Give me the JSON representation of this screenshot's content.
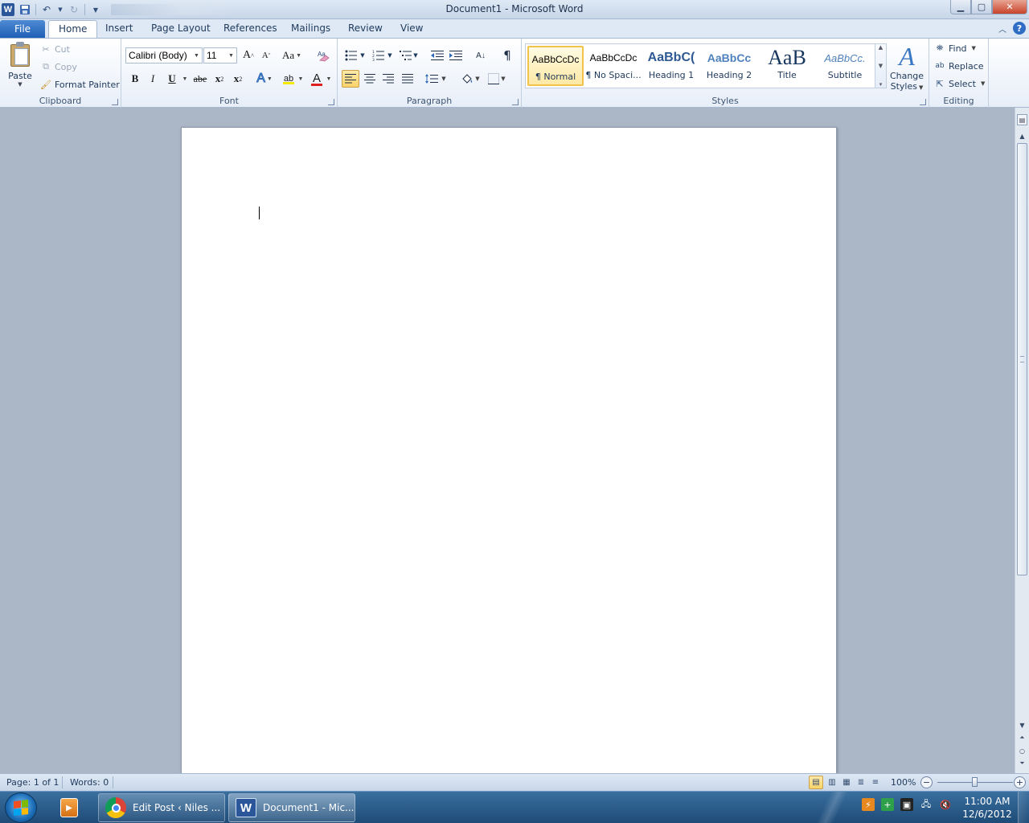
{
  "window": {
    "title": "Document1  -  Microsoft Word",
    "qat_icons": [
      "word-logo-icon",
      "save-icon",
      "undo-icon",
      "redo-icon",
      "customize-qat-icon"
    ],
    "controls": {
      "minimize": "▁",
      "maximize": "▢",
      "close": "✕"
    }
  },
  "tabs": {
    "file": "File",
    "items": [
      "Home",
      "Insert",
      "Page Layout",
      "References",
      "Mailings",
      "Review",
      "View"
    ],
    "active": "Home",
    "help": "?"
  },
  "ribbon": {
    "clipboard": {
      "label": "Clipboard",
      "paste": "Paste",
      "cut": "Cut",
      "copy": "Copy",
      "format_painter": "Format Painter"
    },
    "font": {
      "label": "Font",
      "font_name": "Calibri (Body)",
      "font_size": "11",
      "grow": "A",
      "shrink": "A",
      "change_case": "Aa",
      "bold": "B",
      "italic": "I",
      "underline": "U",
      "strike": "abe",
      "subscript": "x",
      "superscript": "x",
      "text_effects": "A",
      "highlight": "ab",
      "font_color": "A",
      "colors": {
        "font_color": "#e02020",
        "highlight": "#f4e800"
      }
    },
    "paragraph": {
      "label": "Paragraph",
      "show_marks": "¶",
      "sort": "A↓"
    },
    "styles": {
      "label": "Styles",
      "items": [
        {
          "sample": "AaBbCcDc",
          "name": "¶ Normal"
        },
        {
          "sample": "AaBbCcDc",
          "name": "¶ No Spaci..."
        },
        {
          "sample": "AaBbC(",
          "name": "Heading 1"
        },
        {
          "sample": "AaBbCc",
          "name": "Heading 2"
        },
        {
          "sample": "AaB",
          "name": "Title"
        },
        {
          "sample": "AaBbCc.",
          "name": "Subtitle"
        }
      ],
      "selected": "¶ Normal",
      "change_styles_line1": "Change",
      "change_styles_line2": "Styles"
    },
    "editing": {
      "label": "Editing",
      "find": "Find",
      "replace": "Replace",
      "select": "Select"
    }
  },
  "status": {
    "page": "Page: 1 of 1",
    "words": "Words: 0",
    "zoom": "100%",
    "zoom_level_percent": 100
  },
  "taskbar": {
    "tasks": [
      {
        "label": "Edit Post ‹ Niles ...",
        "icon": "chrome-icon"
      },
      {
        "label": "Document1 - Mic...",
        "icon": "word-icon"
      }
    ],
    "time": "11:00 AM",
    "date": "12/6/2012"
  }
}
